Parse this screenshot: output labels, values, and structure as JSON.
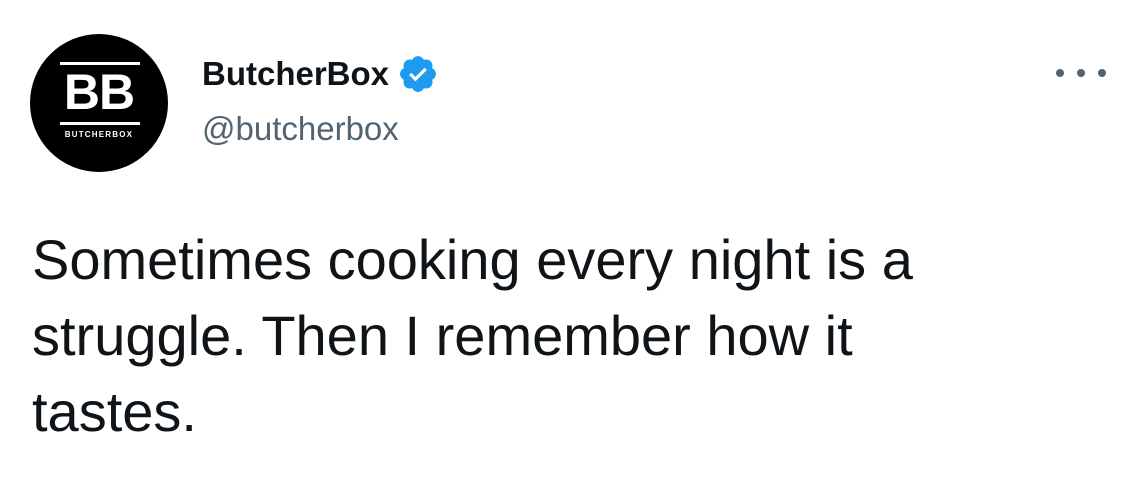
{
  "tweet": {
    "display_name": "ButcherBox",
    "handle": "@butcherbox",
    "text": "Sometimes cooking every night is a\nstruggle. Then I remember how it\ntastes.",
    "verified": true
  },
  "avatar": {
    "mark": "BB",
    "sub": "BUTCHERBOX"
  },
  "icons": {
    "verified": "verified-badge-icon",
    "more": "more-options-icon"
  },
  "colors": {
    "text": "#0f1419",
    "secondary": "#536471",
    "verified_blue": "#1d9bf0",
    "avatar_bg": "#000000"
  }
}
